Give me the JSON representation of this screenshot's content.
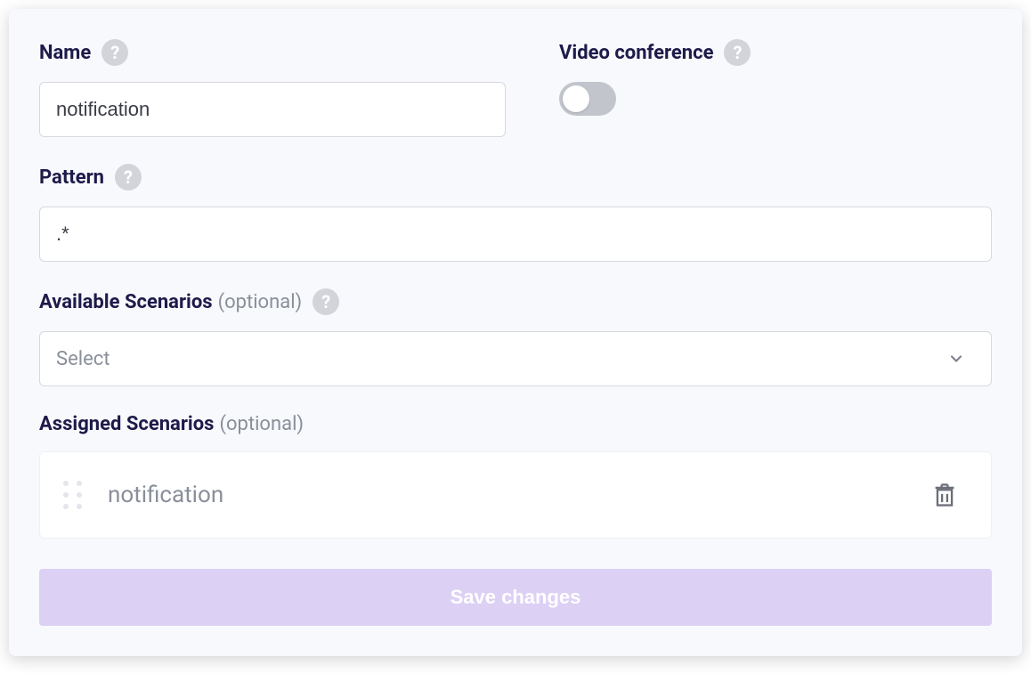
{
  "form": {
    "name": {
      "label": "Name",
      "value": "notification"
    },
    "video": {
      "label": "Video conference",
      "enabled": false
    },
    "pattern": {
      "label": "Pattern",
      "value": ".*"
    },
    "available": {
      "label": "Available Scenarios",
      "optional": "(optional)",
      "placeholder": "Select"
    },
    "assigned": {
      "label": "Assigned Scenarios",
      "optional": "(optional)",
      "items": [
        {
          "label": "notification"
        }
      ]
    },
    "save_label": "Save changes"
  },
  "glyphs": {
    "help": "?"
  }
}
